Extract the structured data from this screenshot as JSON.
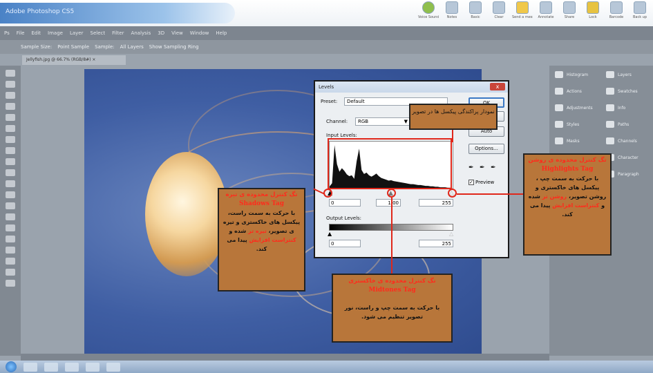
{
  "window": {
    "title": "Adobe Photoshop CS5"
  },
  "quick_access": [
    "Voice Sound",
    "Notes",
    "Basic",
    "Clear",
    "Send a message",
    "Annotate",
    "Share",
    "Lock",
    "Barcode",
    "Back up"
  ],
  "ps_menu": [
    "Ps",
    "File",
    "Edit",
    "Image",
    "Layer",
    "Select",
    "Filter",
    "Analysis",
    "3D",
    "View",
    "Window",
    "Help"
  ],
  "ps_options": [
    "Sample Size:",
    "Point Sample",
    "Sample:",
    "All Layers",
    "Show Sampling Ring"
  ],
  "document_tab": "Jellyfish.jpg @ 66.7% (RGB/8#) ×",
  "panels": {
    "left": [
      "Histogram",
      "Actions",
      "Adjustments",
      "Styles",
      "Masks"
    ],
    "right": [
      "Layers",
      "Swatches",
      "Info",
      "Paths",
      "Channels",
      "Character",
      "Paragraph"
    ]
  },
  "levels": {
    "title": "Levels",
    "preset_label": "Preset:",
    "preset_value": "Default",
    "channel_label": "Channel:",
    "channel_value": "RGB",
    "input_label": "Input Levels:",
    "input_values": [
      "0",
      "1.00",
      "255"
    ],
    "output_label": "Output Levels:",
    "output_values": [
      "0",
      "255"
    ],
    "buttons": {
      "ok": "OK",
      "cancel": "Cancel",
      "auto": "Auto",
      "options": "Options..."
    },
    "preview_label": "Preview",
    "close_glyph": "x",
    "histogram": [
      0.05,
      0.12,
      0.98,
      0.55,
      0.38,
      0.46,
      0.4,
      0.32,
      0.28,
      0.3,
      0.22,
      0.62,
      0.9,
      0.42,
      0.33,
      0.36,
      0.3,
      0.27,
      0.3,
      0.34,
      0.28,
      0.24,
      0.22,
      0.2,
      0.18,
      0.19,
      0.17,
      0.16,
      0.15,
      0.14,
      0.13,
      0.12,
      0.11,
      0.1,
      0.1,
      0.09,
      0.08,
      0.08,
      0.07,
      0.06,
      0.06,
      0.05,
      0.05,
      0.04,
      0.04,
      0.03,
      0.03,
      0.03,
      0.02,
      0.02
    ]
  },
  "callouts": {
    "histogram": {
      "text": "نمودار پراکندگی پیکسل ها در تصویر"
    },
    "shadows": {
      "title": "تگ کنترل محدوده ی تیره",
      "en": "Shadows Tag",
      "body_pre": "با حرکت به سمت راست، پیکسل های خاکستری و تیره ی تصویر،",
      "hl1": "تیره تر",
      "mid": "شده و",
      "hl2": "کنتراست افزایش",
      "body_post": "پیدا می کند."
    },
    "midtones": {
      "title": "تگ کنترل محدوده ی خاکستری",
      "en": "Midtones Tag",
      "body": "با حرکت به سمت چپ و راست، نور تصویر تنظیم می شود."
    },
    "highlights": {
      "title": "تگ کنترل محدوده ی روشن",
      "en": "Highlights Tag",
      "body_pre": "با حرکت به سمت چپ ، پیکسل های خاکستری و روشن تصویر،",
      "hl1": "روشن تر",
      "mid": "شده و",
      "hl2": "کنتراست افزایش",
      "body_post": "پیدا می کند."
    }
  },
  "colors": {
    "callout_bg": "#b8763a",
    "accent_red": "#e0271a"
  }
}
